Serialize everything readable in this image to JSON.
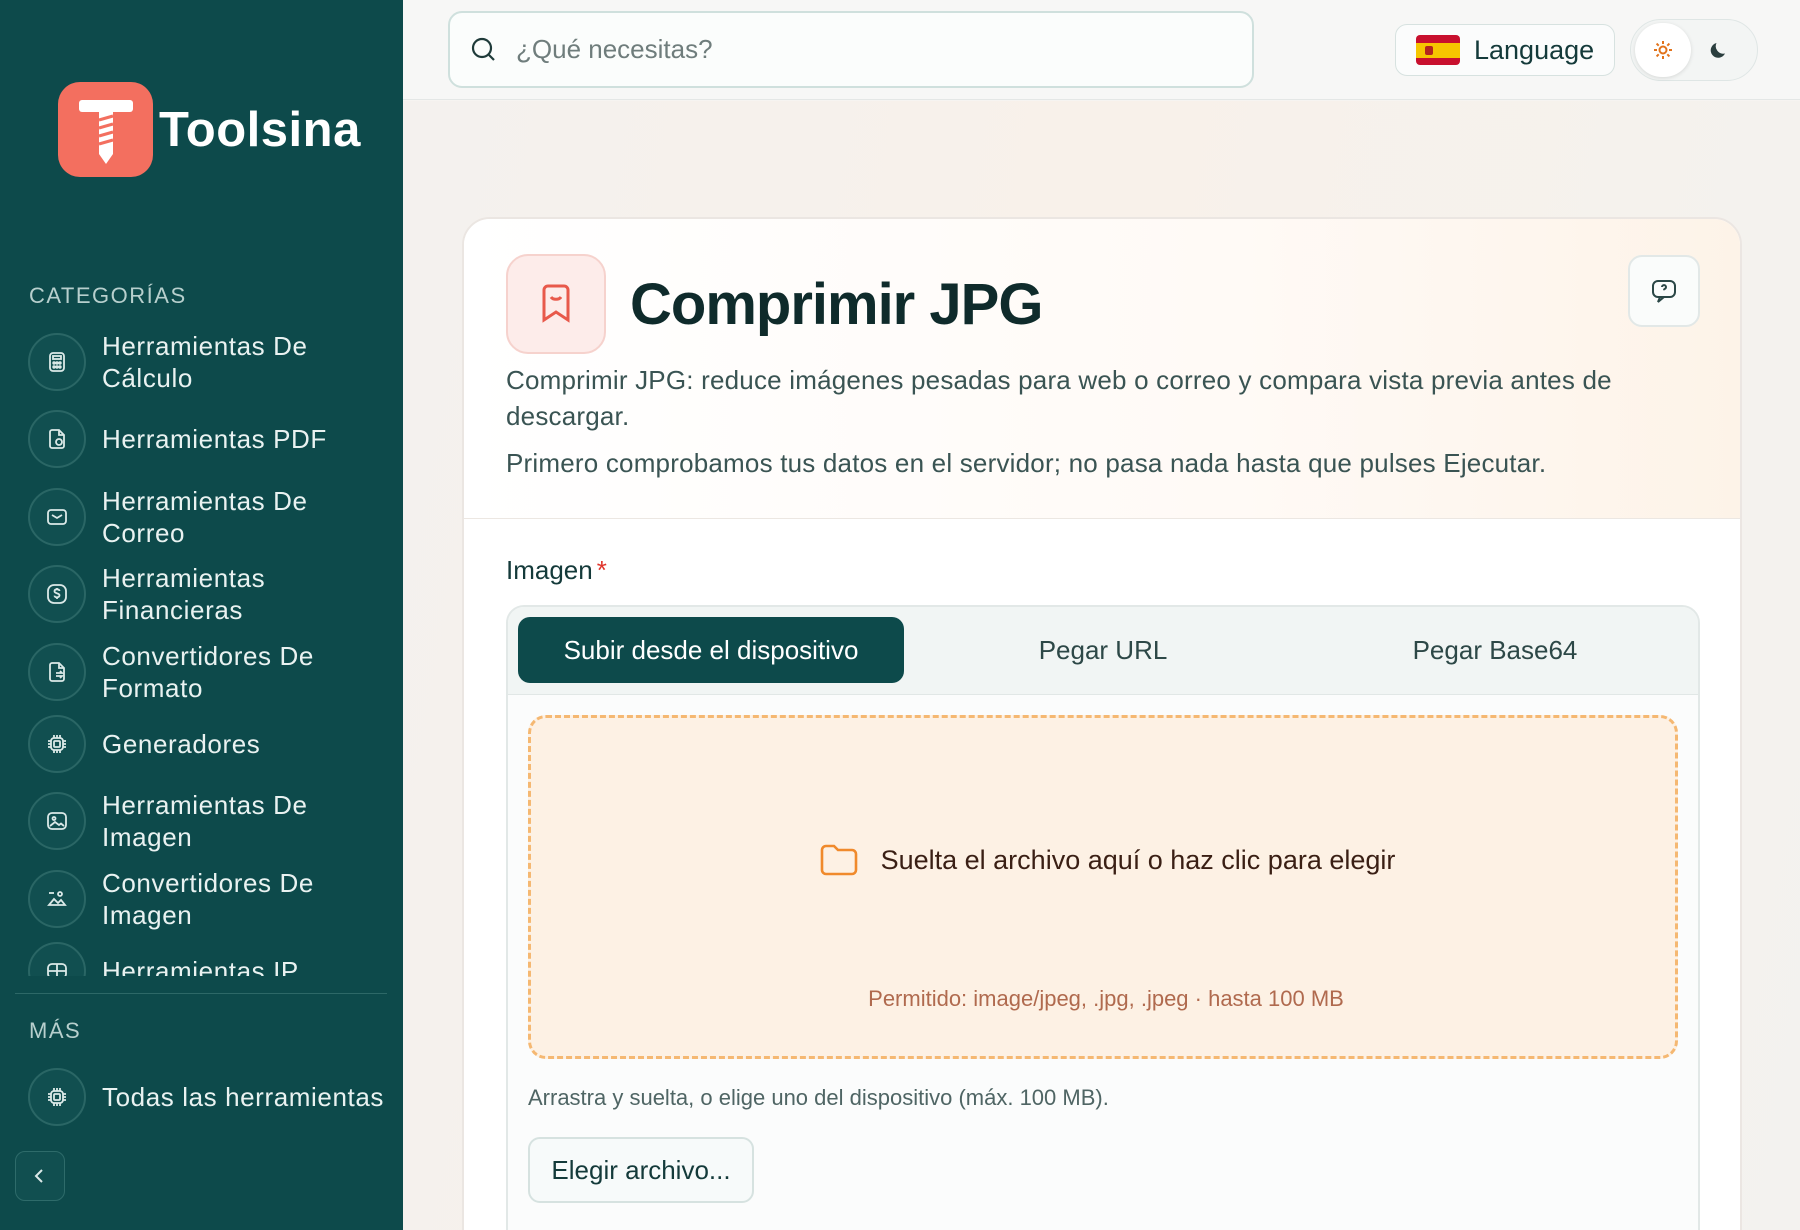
{
  "brand": {
    "name": "Toolsina"
  },
  "sidebar": {
    "categories_title": "CATEGORÍAS",
    "items": [
      {
        "label": "Herramientas De Cálculo",
        "icon": "calculator-icon"
      },
      {
        "label": "Herramientas PDF",
        "icon": "pdf-file-icon"
      },
      {
        "label": "Herramientas De Correo",
        "icon": "mail-icon"
      },
      {
        "label": "Herramientas Financieras",
        "icon": "dollar-icon"
      },
      {
        "label": "Convertidores De Formato",
        "icon": "file-convert-icon"
      },
      {
        "label": "Generadores",
        "icon": "chip-icon"
      },
      {
        "label": "Herramientas De Imagen",
        "icon": "image-icon"
      },
      {
        "label": "Convertidores De Imagen",
        "icon": "image-convert-icon"
      },
      {
        "label": "Herramientas IP",
        "icon": "network-icon"
      }
    ],
    "more_title": "MÁS",
    "more_items": [
      {
        "label": "Todas las herramientas",
        "icon": "chip-icon"
      }
    ]
  },
  "topbar": {
    "search_placeholder": "¿Qué necesitas?",
    "language_label": "Language"
  },
  "tool": {
    "title": "Comprimir JPG",
    "description_1": "Comprimir JPG: reduce imágenes pesadas para web o correo y compara vista previa antes de descargar.",
    "description_2": "Primero comprobamos tus datos en el servidor; no pasa nada hasta que pulses Ejecutar.",
    "field_label": "Imagen",
    "required_mark": "*",
    "tabs": [
      "Subir desde el dispositivo",
      "Pegar URL",
      "Pegar Base64"
    ],
    "active_tab": 0,
    "dropzone_text": "Suelta el archivo aquí o haz clic para elegir",
    "dropzone_hint": "Permitido: image/jpeg, .jpg, .jpeg · hasta 100 MB",
    "helper_text": "Arrastra y suelta, o elige uno del dispositivo (máx. 100 MB).",
    "choose_button": "Elegir archivo..."
  },
  "colors": {
    "sidebar_bg": "#0d4a4b",
    "accent": "#f36f5f",
    "dropzone_border": "#f5b872",
    "dropzone_bg": "#fdf1e4"
  }
}
